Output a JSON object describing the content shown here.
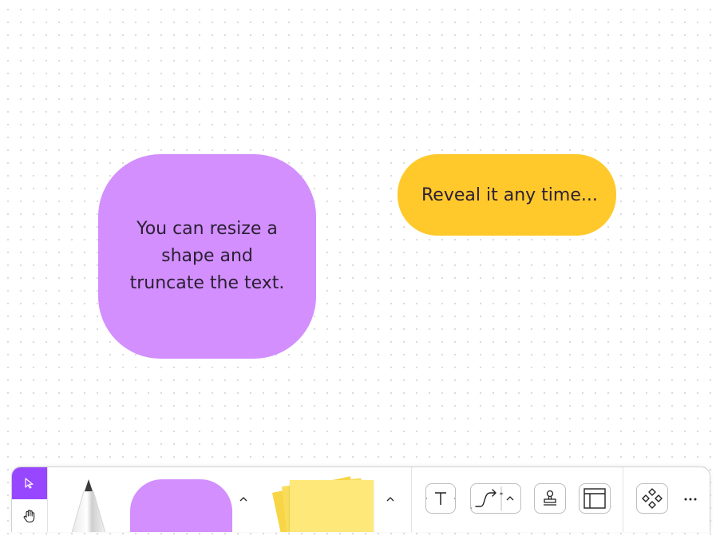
{
  "canvas": {
    "shapes": [
      {
        "text": "You can resize a shape and truncate the text.",
        "color": "#d28ffd"
      },
      {
        "text": "Reveal it any time...",
        "color": "#ffc92c"
      }
    ]
  },
  "toolbar": {
    "accent": "#9747ff",
    "mode": {
      "active": "select",
      "icons": [
        "cursor-icon",
        "hand-icon"
      ]
    },
    "tools": [
      "pencil-icon",
      "shape-icon",
      "chevron-up-icon",
      "sticky-note-icon",
      "text-icon",
      "connector-icon",
      "stamp-icon",
      "section-icon",
      "components-icon",
      "more-icon"
    ]
  }
}
